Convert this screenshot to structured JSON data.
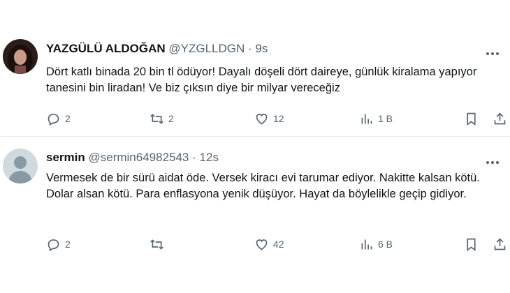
{
  "tweets": [
    {
      "name": "YAZGÜLÜ ALDOĞAN",
      "handle": "@YZGLLDGN",
      "separator": "·",
      "time": "9s",
      "text": "Dört katlı binada 20 bin tl ödüyor! Dayalı döşeli dört daireye, günlük kiralama yapıyor tanesini bin liradan! Ve biz çıksın diye bir milyar vereceğiz",
      "replies": "2",
      "retweets": "2",
      "likes": "12",
      "views": "1 B",
      "avatar_icon": "profile-photo-icon"
    },
    {
      "name": "sermin",
      "handle": "@sermin64982543",
      "separator": "·",
      "time": "12s",
      "text": "Vermesek de bir sürü aidat öde. Versek kiracı evi tarumar ediyor. Nakitte kalsan kötü. Dolar alsan kötü. Para enflasyona yenik düşüyor. Hayat da böylelikle geçip gidiyor.",
      "replies": "2",
      "retweets": "",
      "likes": "42",
      "views": "6 B",
      "avatar_icon": "default-avatar-icon"
    }
  ],
  "colors": {
    "text": "#0f1419",
    "muted": "#536471",
    "divider": "#e6ecf0"
  }
}
